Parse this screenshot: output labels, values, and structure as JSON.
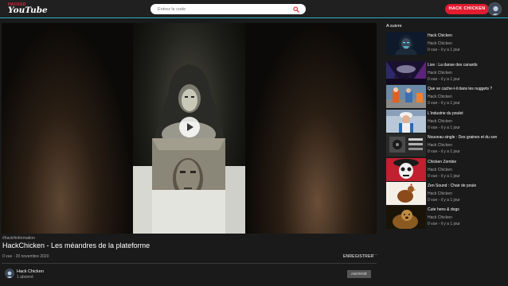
{
  "header": {
    "logo_small": "HACKED",
    "logo_main": "YouTube",
    "search_placeholder": "Entrez le code",
    "hack_button": "HACK CHICKEN"
  },
  "video": {
    "hashtags": "#hack#information",
    "title": "HackChicken - Les méandres de la plateforme",
    "views_date": "0 vue · 20 novembre 2020",
    "save_label": "ENREGISTRER",
    "more_label": "···"
  },
  "channel": {
    "name": "Hack Chicken",
    "subscribers": "1 abonné",
    "subscribe_label": "ABONNÉ"
  },
  "sidebar": {
    "heading": "A suivre",
    "items": [
      {
        "title": "Hack Chicken",
        "channel": "Hack Chicken",
        "meta": "0 vue - il y a 1 jour",
        "thumb": "masked-hacker"
      },
      {
        "title": "Live : La danse des canards",
        "channel": "Hack Chicken",
        "meta": "0 vue - il y a 1 jour",
        "thumb": "concert"
      },
      {
        "title": "Que se cache-t-il dans les nuggets ?",
        "channel": "Hack Chicken",
        "meta": "0 vue - il y a 1 jour",
        "thumb": "factory"
      },
      {
        "title": "L'industrie du poulet",
        "channel": "Hack Chicken",
        "meta": "0 vue - il y a 1 jour",
        "thumb": "worker"
      },
      {
        "title": "Nouveau single : Des graines et du son",
        "channel": "Hack Chicken",
        "meta": "0 vue - il y a 1 jour",
        "thumb": "studio"
      },
      {
        "title": "Chicken Zombie",
        "channel": "Hack Chicken",
        "meta": "0 vue - il y a 1 jour",
        "thumb": "skull"
      },
      {
        "title": "Zen Sound : Chair de poule",
        "channel": "Hack Chicken",
        "meta": "0 vue - il y a 1 jour",
        "thumb": "hen"
      },
      {
        "title": "Cute hens & dogs",
        "channel": "Hack Chicken",
        "meta": "0 vue - il y a 1 jour",
        "thumb": "dog"
      }
    ]
  },
  "colors": {
    "accent": "#2bb3c4",
    "brand_red": "#e21b2f",
    "background": "#1a1a1a"
  }
}
